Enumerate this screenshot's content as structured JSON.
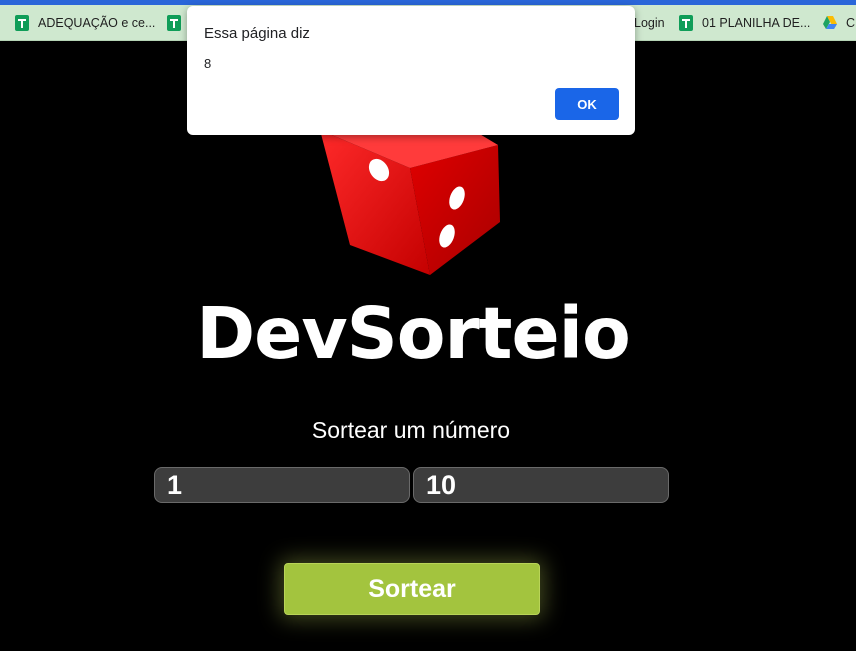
{
  "bookmarks_bar": {
    "items": [
      {
        "label": "ADEQUAÇÃO e ce...",
        "icon": "google-sheets-icon"
      },
      {
        "label": "",
        "icon": "google-sheets-icon"
      },
      {
        "label": "Login",
        "icon": ""
      },
      {
        "label": "01 PLANILHA DE...",
        "icon": "google-sheets-icon"
      },
      {
        "label": "C",
        "icon": "google-drive-icon"
      }
    ]
  },
  "app": {
    "logo_text": "DevSorteio",
    "logo_image": "red-dice-icon",
    "subtitle": "Sortear um número",
    "min_value": "1",
    "max_value": "10",
    "draw_button_label": "Sortear"
  },
  "alert_dialog": {
    "title": "Essa página diz",
    "message": "8",
    "ok_label": "OK"
  },
  "colors": {
    "page_background": "#000000",
    "button_green": "#a3c43e",
    "dice_red": "#e10000",
    "dialog_ok_blue": "#1a66e8",
    "bookmarks_bar": "#cfe8cf",
    "input_background": "#3d3d3d"
  }
}
